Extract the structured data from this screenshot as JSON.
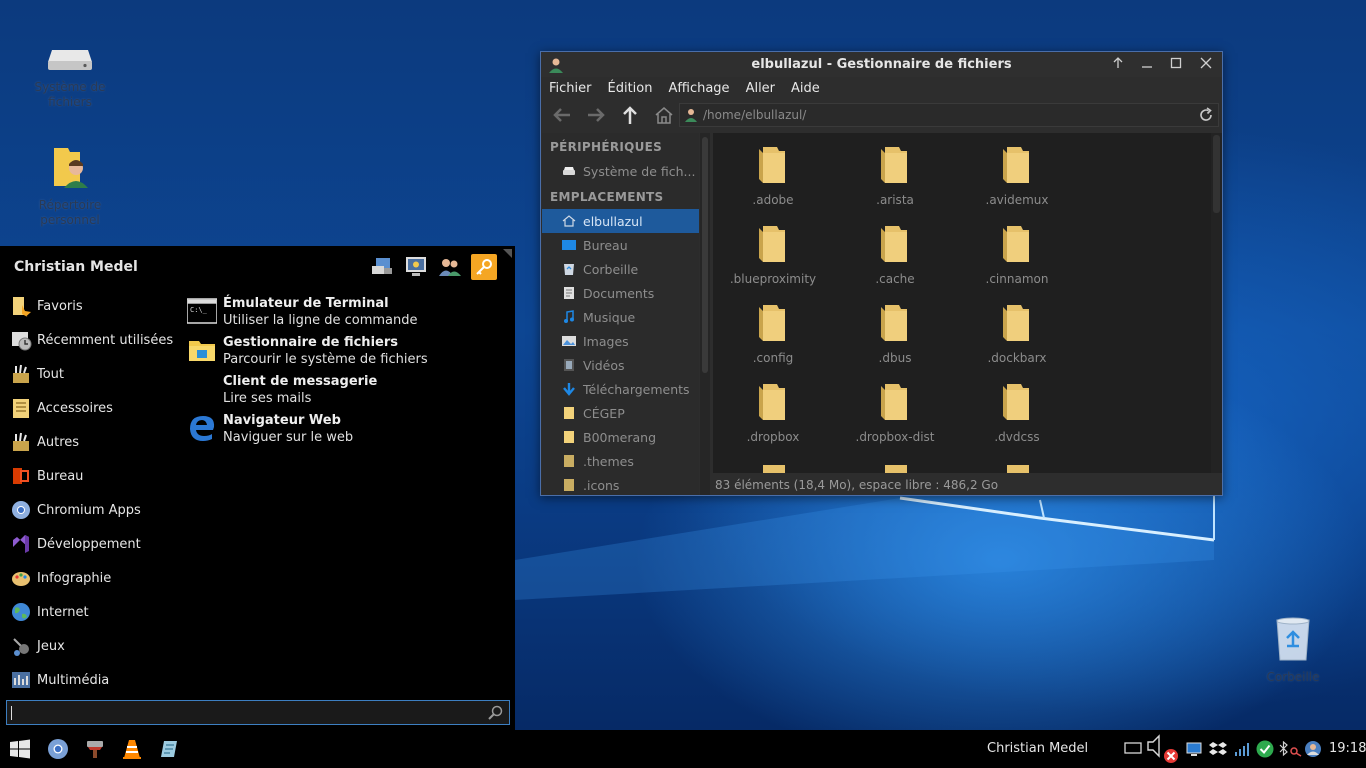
{
  "desktop": {
    "icons": [
      {
        "label": "Système de fichiers"
      },
      {
        "label": "Répertoire personnel"
      },
      {
        "label": "Corbeille"
      }
    ]
  },
  "file_manager": {
    "title": "elbullazul - Gestionnaire de fichiers",
    "menu": [
      {
        "label": "Fichier"
      },
      {
        "label": "Édition"
      },
      {
        "label": "Affichage"
      },
      {
        "label": "Aller"
      },
      {
        "label": "Aide"
      }
    ],
    "location": "/home/elbullazul/",
    "sidebar": {
      "devices_header": "PÉRIPHÉRIQUES",
      "devices": [
        {
          "label": "Système de fich...",
          "icon": "drive-icon"
        }
      ],
      "places_header": "EMPLACEMENTS",
      "places": [
        {
          "label": "elbullazul",
          "icon": "home-icon"
        },
        {
          "label": "Bureau",
          "icon": "desktop-icon"
        },
        {
          "label": "Corbeille",
          "icon": "trash-icon"
        },
        {
          "label": "Documents",
          "icon": "documents-icon"
        },
        {
          "label": "Musique",
          "icon": "music-icon"
        },
        {
          "label": "Images",
          "icon": "images-icon"
        },
        {
          "label": "Vidéos",
          "icon": "videos-icon"
        },
        {
          "label": "Téléchargements",
          "icon": "download-icon"
        },
        {
          "label": "CÉGEP",
          "icon": "folder-icon"
        },
        {
          "label": "B00merang",
          "icon": "folder-icon"
        },
        {
          "label": ".themes",
          "icon": "folder-icon"
        },
        {
          "label": ".icons",
          "icon": "folder-icon"
        }
      ]
    },
    "files": [
      {
        "name": ".adobe"
      },
      {
        "name": ".arista"
      },
      {
        "name": ".avidemux"
      },
      {
        "name": ".blueproximity"
      },
      {
        "name": ".cache"
      },
      {
        "name": ".cinnamon"
      },
      {
        "name": ".config"
      },
      {
        "name": ".dbus"
      },
      {
        "name": ".dockbarx"
      },
      {
        "name": ".dropbox"
      },
      {
        "name": ".dropbox-dist"
      },
      {
        "name": ".dvdcss"
      }
    ],
    "status": "83 éléments (18,4 Mo), espace libre : 486,2 Go"
  },
  "menu": {
    "user": "Christian Medel",
    "categories": [
      {
        "label": "Favoris",
        "icon": "favorites-icon"
      },
      {
        "label": "Récemment utilisées",
        "icon": "recent-icon"
      },
      {
        "label": "Tout",
        "icon": "all-icon"
      },
      {
        "label": "Accessoires",
        "icon": "accessories-icon"
      },
      {
        "label": "Autres",
        "icon": "others-icon"
      },
      {
        "label": "Bureau",
        "icon": "office-icon"
      },
      {
        "label": "Chromium Apps",
        "icon": "chromium-icon"
      },
      {
        "label": "Développement",
        "icon": "development-icon"
      },
      {
        "label": "Infographie",
        "icon": "graphics-icon"
      },
      {
        "label": "Internet",
        "icon": "internet-icon"
      },
      {
        "label": "Jeux",
        "icon": "games-icon"
      },
      {
        "label": "Multimédia",
        "icon": "multimedia-icon"
      }
    ],
    "apps": [
      {
        "name": "Émulateur de Terminal",
        "desc": "Utiliser la ligne de commande",
        "icon": "terminal-icon"
      },
      {
        "name": "Gestionnaire de fichiers",
        "desc": "Parcourir le système de fichiers",
        "icon": "file-manager-icon"
      },
      {
        "name": "Client de messagerie",
        "desc": "Lire ses mails",
        "icon": "mail-icon"
      },
      {
        "name": "Navigateur Web",
        "desc": "Naviguer sur le web",
        "icon": "edge-icon"
      }
    ],
    "search_placeholder": ""
  },
  "taskbar": {
    "user": "Christian Medel",
    "clock": "19:18"
  }
}
